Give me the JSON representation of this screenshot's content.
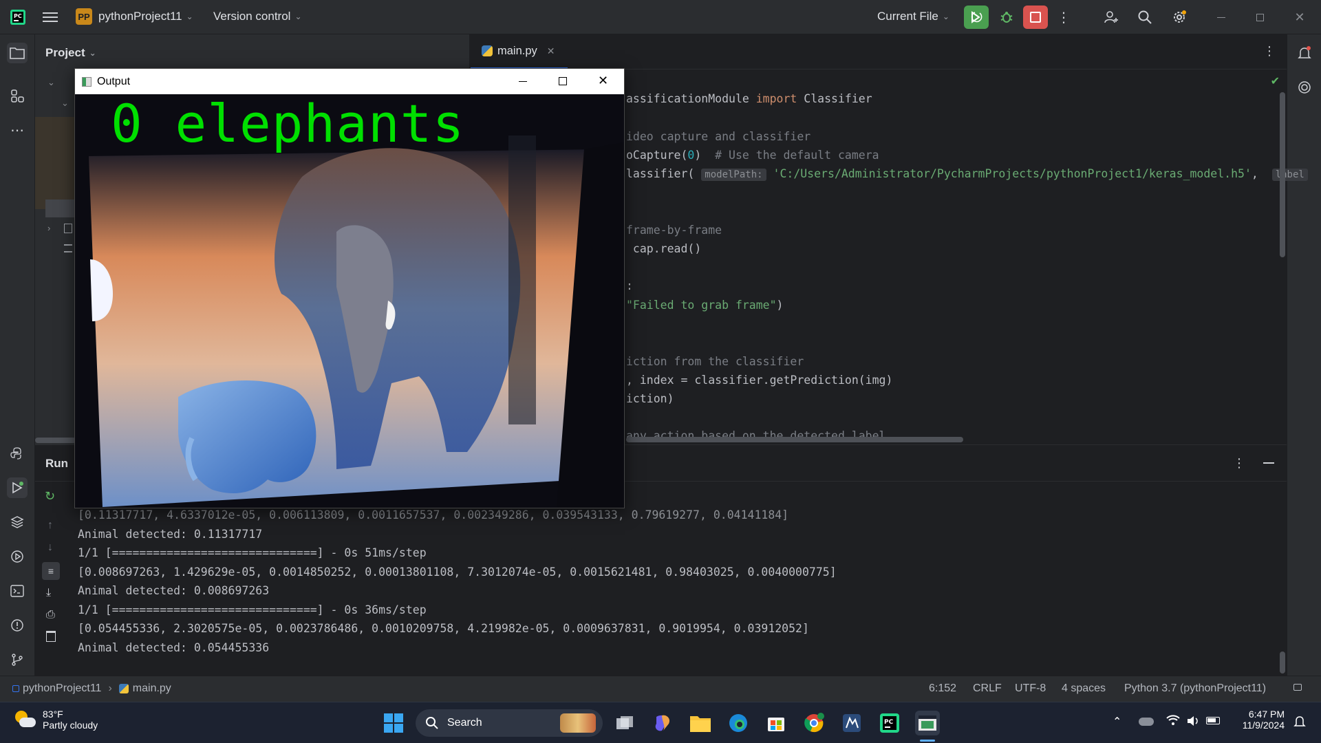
{
  "titlebar": {
    "project_badge": "PP",
    "project_name": "pythonProject11",
    "vcs": "Version control",
    "run_config": "Current File"
  },
  "project_panel": {
    "title": "Project"
  },
  "editor": {
    "tab_label": "main.py",
    "lines": {
      "l1a": "assificationModule ",
      "l1kw": "import",
      "l1b": " Classifier",
      "l2": "ideo capture and classifier",
      "l3a": "oCapture(",
      "l3num": "0",
      "l3b": ")  ",
      "l3cm": "# Use the default camera",
      "l4a": "lassifier( ",
      "l4hint": "modelPath:",
      "l4str": " 'C:/Users/Administrator/PycharmProjects/pythonProject1/keras_model.h5'",
      "l4b": ",  ",
      "l4hint2": "label",
      "l5": "frame-by-frame",
      "l6": " cap.read()",
      "l7": ":",
      "l8": "\"Failed to grab frame\"",
      "l8b": ")",
      "l9": "iction from the classifier",
      "l10": ", index = classifier.getPrediction(img)",
      "l11": "iction)",
      "l12": "any action based on the detected label"
    }
  },
  "run_panel": {
    "title": "Run",
    "output": [
      "[0.11317717, 4.6337012e-05, 0.006113809, 0.0011657537, 0.002349286, 0.039543133, 0.79619277, 0.04141184]",
      "Animal detected: 0.11317717",
      "1/1 [==============================] - 0s 51ms/step",
      "[0.008697263, 1.429629e-05, 0.0014850252, 0.00013801108, 7.3012074e-05, 0.0015621481, 0.98403025, 0.0040000775]",
      "Animal detected: 0.008697263",
      "1/1 [==============================] - 0s 36ms/step",
      "[0.054455336, 2.3020575e-05, 0.0023786486, 0.0010209758, 4.219982e-05, 0.0009637831, 0.9019954, 0.03912052]",
      "Animal detected: 0.054455336"
    ]
  },
  "output_window": {
    "title": "Output",
    "overlay_text": "0 elephants"
  },
  "statusbar": {
    "crumb_project": "pythonProject11",
    "crumb_file": "main.py",
    "position": "6:152",
    "line_sep": "CRLF",
    "encoding": "UTF-8",
    "indent": "4 spaces",
    "interpreter": "Python 3.7 (pythonProject11)"
  },
  "taskbar": {
    "weather_temp": "83°F",
    "weather_desc": "Partly cloudy",
    "search_label": "Search",
    "time": "6:47 PM",
    "date": "11/9/2024"
  },
  "colors": {
    "accent_run": "#5fb865",
    "stop_red": "#d9534f",
    "overlay_green": "#00e000"
  }
}
